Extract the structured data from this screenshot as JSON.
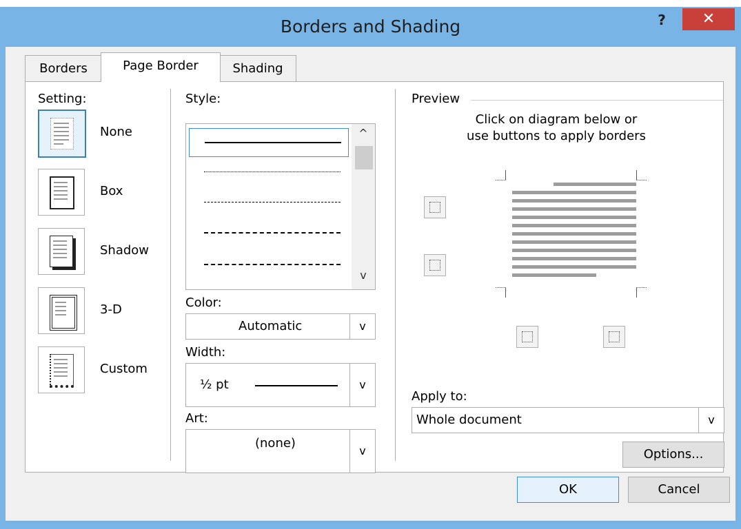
{
  "window": {
    "title": "Borders and Shading",
    "help_label": "?",
    "close_label": "✕"
  },
  "tabs": [
    {
      "label": "Borders",
      "active": false
    },
    {
      "label": "Page Border",
      "active": true
    },
    {
      "label": "Shading",
      "active": false
    }
  ],
  "setting": {
    "heading": "Setting:",
    "options": [
      {
        "label": "None",
        "icon": "none-setting-icon",
        "selected": true
      },
      {
        "label": "Box",
        "icon": "box-setting-icon",
        "selected": false
      },
      {
        "label": "Shadow",
        "icon": "shadow-setting-icon",
        "selected": false
      },
      {
        "label": "3-D",
        "icon": "3d-setting-icon",
        "selected": false
      },
      {
        "label": "Custom",
        "icon": "custom-setting-icon",
        "selected": false
      }
    ]
  },
  "style": {
    "heading": "Style:",
    "options": [
      "solid",
      "dotted",
      "dashed-small",
      "dashed",
      "dash-dot"
    ],
    "selected": "solid"
  },
  "color": {
    "label": "Color:",
    "value": "Automatic"
  },
  "width": {
    "label": "Width:",
    "value": "½ pt"
  },
  "art": {
    "label": "Art:",
    "value": "(none)"
  },
  "preview": {
    "heading": "Preview",
    "instruction_1": "Click on diagram below or",
    "instruction_2": "use buttons to apply borders"
  },
  "apply_to": {
    "label": "Apply to:",
    "value": "Whole document"
  },
  "buttons": {
    "options": "Options...",
    "ok": "OK",
    "cancel": "Cancel"
  },
  "colors": {
    "title_bar": "#79b4e6",
    "close": "#c9403b",
    "accent": "#3c8fd6"
  }
}
